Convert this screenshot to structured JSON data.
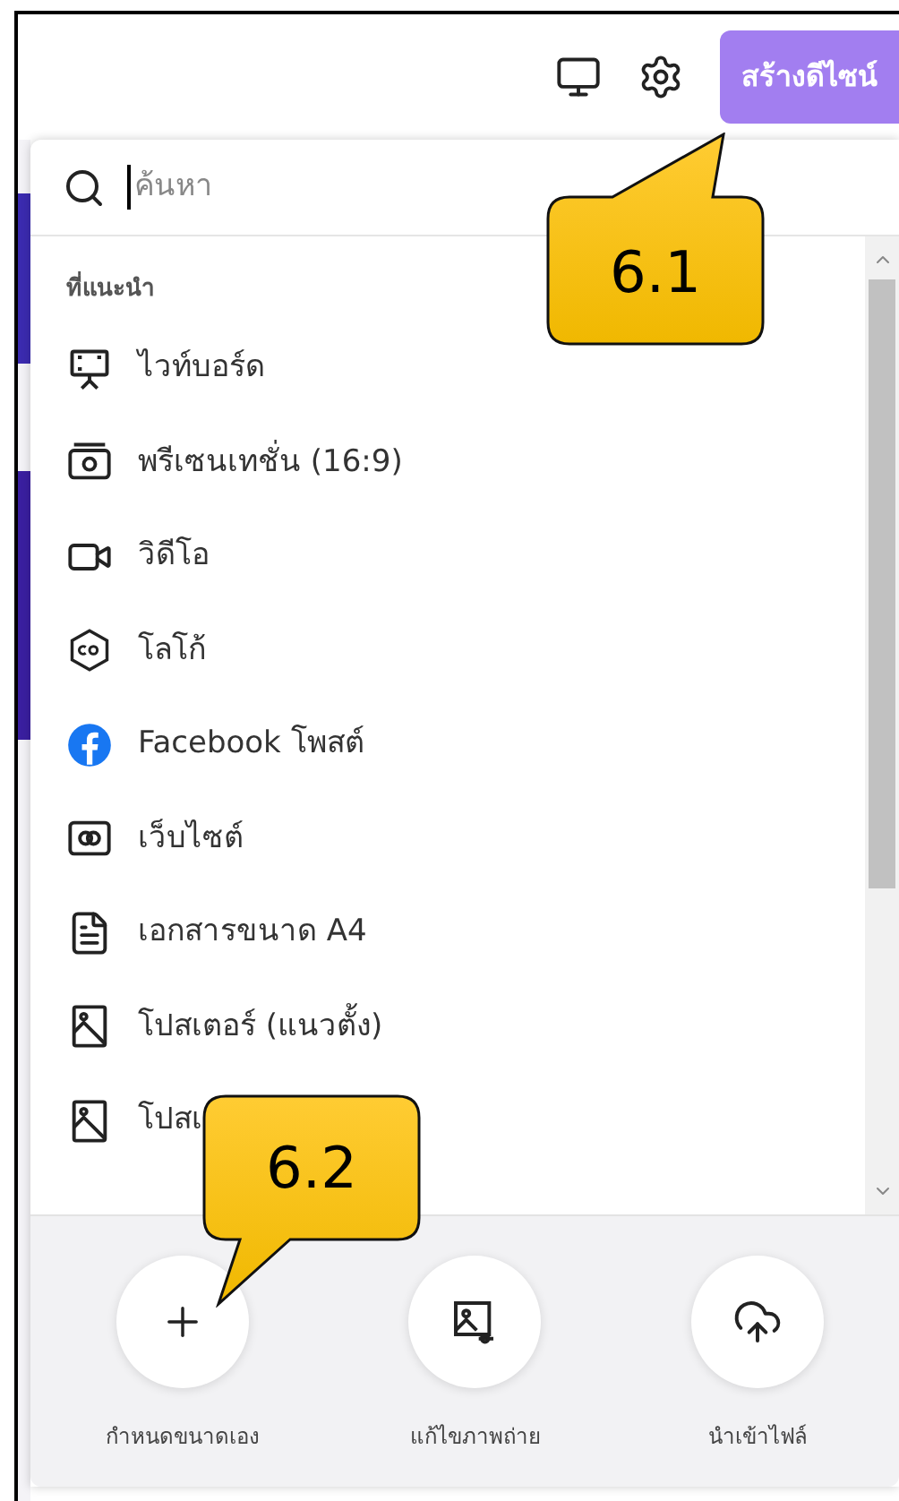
{
  "header": {
    "create_button": "สร้างดีไซน์"
  },
  "search": {
    "placeholder": "ค้นหา"
  },
  "section_title": "ที่แนะนำ",
  "items": [
    {
      "kind": "whiteboard",
      "label": "ไวท์บอร์ด"
    },
    {
      "kind": "presentation",
      "label": "พรีเซนเทชั่น (16:9)"
    },
    {
      "kind": "video",
      "label": "วิดีโอ"
    },
    {
      "kind": "logo",
      "label": "โลโก้"
    },
    {
      "kind": "facebook",
      "label": "Facebook โพสต์"
    },
    {
      "kind": "website",
      "label": "เว็บไซต์"
    },
    {
      "kind": "document",
      "label": "เอกสารขนาด A4"
    },
    {
      "kind": "poster",
      "label": "โปสเตอร์ (แนวตั้ง)"
    },
    {
      "kind": "poster",
      "label": "โปสเ"
    }
  ],
  "actions": [
    {
      "kind": "custom",
      "label": "กำหนดขนาดเอง"
    },
    {
      "kind": "photo",
      "label": "แก้ไขภาพถ่าย"
    },
    {
      "kind": "upload",
      "label": "นำเข้าไฟล์"
    }
  ],
  "callouts": [
    {
      "label": "6.1"
    },
    {
      "label": "6.2"
    }
  ]
}
